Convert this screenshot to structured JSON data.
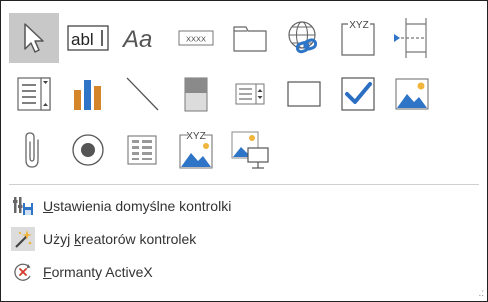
{
  "toolbox": {
    "text_box_glyph": "abl",
    "label_glyph": "Aa",
    "button_glyph": "XXXX",
    "group_glyph": "XYZ",
    "subform_glyph": "XYZ"
  },
  "menu": {
    "defaults": {
      "underline": "U",
      "rest": "stawienia domyślne kontrolki"
    },
    "wizards": {
      "before": "Użyj ",
      "underline": "k",
      "after": "reatorów kontrolek"
    },
    "activex": {
      "underline": "F",
      "rest": "ormanty ActiveX"
    }
  },
  "colors": {
    "accent": "#2e74c7",
    "bars": "#d5862b",
    "check": "#2b6fc2",
    "sun": "#f0b53a"
  }
}
